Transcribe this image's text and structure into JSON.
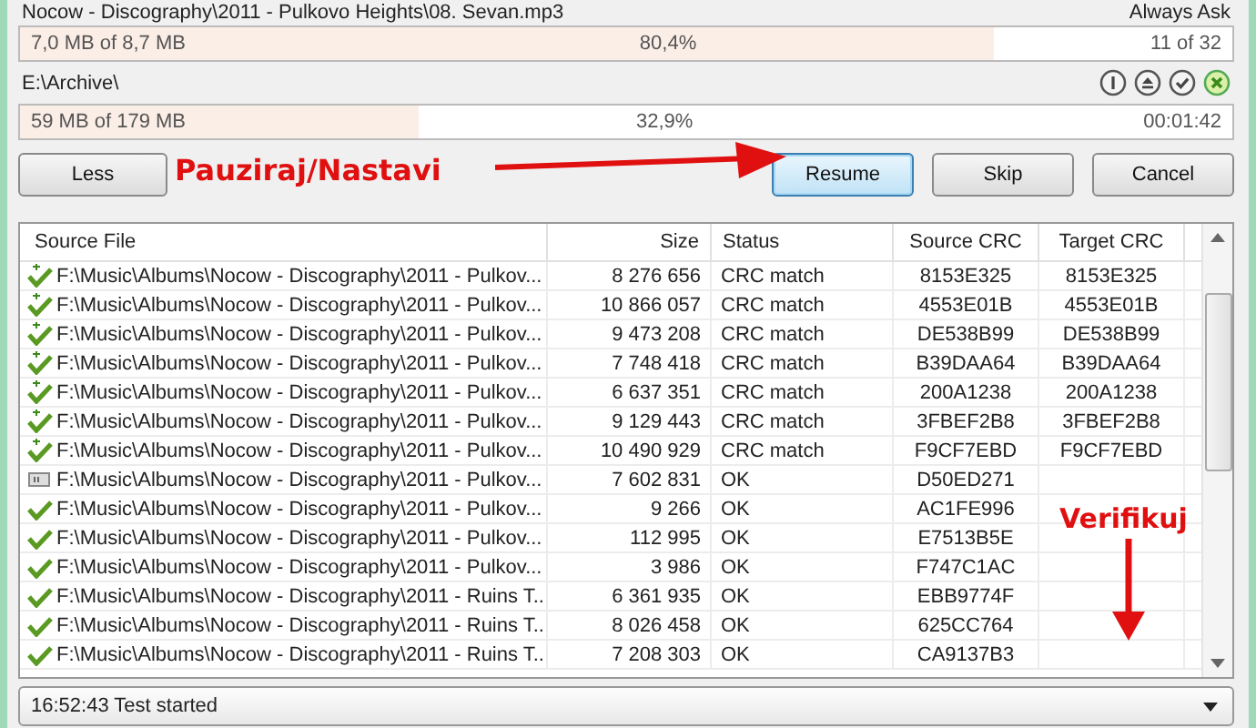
{
  "current_file": {
    "name": "Nocow - Discography\\2011 - Pulkovo Heights\\08. Sevan.mp3",
    "mode": "Always Ask"
  },
  "file_progress": {
    "done": "7,0 MB of 8,7 MB",
    "percent": "80,4%",
    "level": 0.804,
    "count": "11 of 32"
  },
  "target": {
    "path": "E:\\Archive\\"
  },
  "total_progress": {
    "done": "59 MB of 179 MB",
    "percent": "32,9%",
    "level": 0.329,
    "time": "00:01:42"
  },
  "buttons": [
    {
      "label": "Less",
      "default": false
    },
    {
      "label": "Resume",
      "default": true
    },
    {
      "label": "Skip",
      "default": false
    },
    {
      "label": "Cancel",
      "default": false
    }
  ],
  "annotations": [
    {
      "kind": "pause",
      "text": "Pauziraj/Nastavi"
    },
    {
      "kind": "verify",
      "text": "Verifikuj"
    }
  ],
  "table": {
    "columns": [
      "Source File",
      "Size",
      "Status",
      "Source CRC",
      "Target CRC"
    ],
    "rows": [
      {
        "kind": "match",
        "file": "F:\\Music\\Albums\\Nocow - Discography\\2011 - Pulkov...",
        "size": "8 276 656",
        "status": "CRC match",
        "source_crc": "8153E325",
        "target_crc": "8153E325"
      },
      {
        "kind": "match",
        "file": "F:\\Music\\Albums\\Nocow - Discography\\2011 - Pulkov...",
        "size": "10 866 057",
        "status": "CRC match",
        "source_crc": "4553E01B",
        "target_crc": "4553E01B"
      },
      {
        "kind": "match",
        "file": "F:\\Music\\Albums\\Nocow - Discography\\2011 - Pulkov...",
        "size": "9 473 208",
        "status": "CRC match",
        "source_crc": "DE538B99",
        "target_crc": "DE538B99"
      },
      {
        "kind": "match",
        "file": "F:\\Music\\Albums\\Nocow - Discography\\2011 - Pulkov...",
        "size": "7 748 418",
        "status": "CRC match",
        "source_crc": "B39DAA64",
        "target_crc": "B39DAA64"
      },
      {
        "kind": "match",
        "file": "F:\\Music\\Albums\\Nocow - Discography\\2011 - Pulkov...",
        "size": "6 637 351",
        "status": "CRC match",
        "source_crc": "200A1238",
        "target_crc": "200A1238"
      },
      {
        "kind": "match",
        "file": "F:\\Music\\Albums\\Nocow - Discography\\2011 - Pulkov...",
        "size": "9 129 443",
        "status": "CRC match",
        "source_crc": "3FBEF2B8",
        "target_crc": "3FBEF2B8"
      },
      {
        "kind": "match",
        "file": "F:\\Music\\Albums\\Nocow - Discography\\2011 - Pulkov...",
        "size": "10 490 929",
        "status": "CRC match",
        "source_crc": "F9CF7EBD",
        "target_crc": "F9CF7EBD"
      },
      {
        "kind": "queued",
        "file": "F:\\Music\\Albums\\Nocow - Discography\\2011 - Pulkov...",
        "size": "7 602 831",
        "status": "OK",
        "source_crc": "D50ED271"
      },
      {
        "kind": "ok",
        "file": "F:\\Music\\Albums\\Nocow - Discography\\2011 - Pulkov...",
        "size": "9 266",
        "status": "OK",
        "source_crc": "AC1FE996"
      },
      {
        "kind": "ok",
        "file": "F:\\Music\\Albums\\Nocow - Discography\\2011 - Pulkov...",
        "size": "112 995",
        "status": "OK",
        "source_crc": "E7513B5E"
      },
      {
        "kind": "ok",
        "file": "F:\\Music\\Albums\\Nocow - Discography\\2011 - Pulkov...",
        "size": "3 986",
        "status": "OK",
        "source_crc": "F747C1AC"
      },
      {
        "kind": "ok",
        "file": "F:\\Music\\Albums\\Nocow - Discography\\2011 - Ruins T...",
        "size": "6 361 935",
        "status": "OK",
        "source_crc": "EBB9774F"
      },
      {
        "kind": "ok",
        "file": "F:\\Music\\Albums\\Nocow - Discography\\2011 - Ruins T...",
        "size": "8 026 458",
        "status": "OK",
        "source_crc": "625CC764"
      },
      {
        "kind": "ok",
        "file": "F:\\Music\\Albums\\Nocow - Discography\\2011 - Ruins T...",
        "size": "7 208 303",
        "status": "OK",
        "source_crc": "CA9137B3"
      }
    ]
  },
  "log": {
    "value": "16:52:43 Test started"
  }
}
